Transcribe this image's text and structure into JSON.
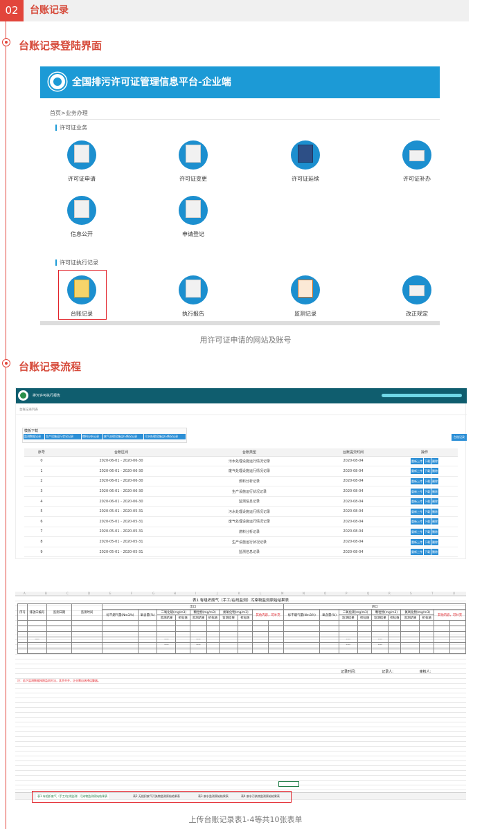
{
  "section": {
    "number": "02",
    "title": "台账记录"
  },
  "part1": {
    "heading": "台账记录登陆界面",
    "screenshot": {
      "topbar_title": "全国排污许可证管理信息平台-企业端",
      "breadcrumb": "首页>业务办理",
      "group1_label": "许可证业务",
      "group1_items": [
        "许可证申请",
        "许可证变更",
        "许可证延续",
        "许可证补办",
        "信息公开",
        "申请登记"
      ],
      "group2_label": "许可证执行记录",
      "group2_items": [
        "台账记录",
        "执行报告",
        "监测记录",
        "改正规定"
      ]
    },
    "caption": "用许可证申请的网站及账号"
  },
  "part2": {
    "heading": "台账记录流程",
    "app": {
      "title": "排污许可执行报告",
      "crumb": "台账记录列表",
      "download_label": "模板下载",
      "template_buttons": [
        "监测数据记录",
        "生产设施运行状况记录",
        "燃料分析记录",
        "废气治理设施运行情况记录",
        "污水处理设施运行情况记录"
      ],
      "right_button": "台账记录",
      "columns": [
        "序号",
        "台账区间",
        "台账类型",
        "台账提交时间",
        "操作"
      ],
      "ops": [
        "重新上传",
        "下载",
        "删除"
      ],
      "rows": [
        {
          "no": "0",
          "range": "2020-06-01 - 2020-06-30",
          "type": "污水处理设施运行情况记录",
          "date": "2020-08-04"
        },
        {
          "no": "1",
          "range": "2020-06-01 - 2020-06-30",
          "type": "废气处理设施运行情况记录",
          "date": "2020-08-04"
        },
        {
          "no": "2",
          "range": "2020-06-01 - 2020-06-30",
          "type": "燃料分析记录",
          "date": "2020-08-04"
        },
        {
          "no": "3",
          "range": "2020-06-01 - 2020-06-30",
          "type": "生产设施运行状况记录",
          "date": "2020-08-04"
        },
        {
          "no": "4",
          "range": "2020-06-01 - 2020-06-30",
          "type": "监测信息记录",
          "date": "2020-08-04"
        },
        {
          "no": "5",
          "range": "2020-05-01 - 2020-05-31",
          "type": "污水处理设施运行情况记录",
          "date": "2020-08-04"
        },
        {
          "no": "6",
          "range": "2020-05-01 - 2020-05-31",
          "type": "废气处理设施运行情况记录",
          "date": "2020-08-04"
        },
        {
          "no": "7",
          "range": "2020-05-01 - 2020-05-31",
          "type": "燃料分析记录",
          "date": "2020-08-04"
        },
        {
          "no": "8",
          "range": "2020-05-01 - 2020-05-31",
          "type": "生产设施运行状况记录",
          "date": "2020-08-04"
        },
        {
          "no": "9",
          "range": "2020-05-01 - 2020-05-31",
          "type": "监测信息记录",
          "date": "2020-08-04"
        }
      ]
    },
    "sheet": {
      "col_letters": [
        "A",
        "B",
        "C",
        "D",
        "E",
        "F",
        "G",
        "H",
        "I",
        "J",
        "K",
        "L",
        "M",
        "N",
        "O",
        "P",
        "Q",
        "R",
        "S",
        "T",
        "U"
      ],
      "title": "表1 有组织废气（手工/在线监测）污染物监测原始结果表",
      "outlet": "出口",
      "inlet": "进口",
      "headers": {
        "seq": "序号",
        "port": "排放口编号",
        "date": "监测日期",
        "time": "监测时间",
        "flow": "标干烟气量(Nm3/h)",
        "oxygen": "氧含量(%)",
        "so2": "二氧化硫(mg/m3)",
        "pm": "颗粒物(mg/m3)",
        "nox": "氮氧化物(mg/m3)",
        "other": "其他内容，可补充",
        "measured": "监测结果",
        "converted": "折标值"
      },
      "dash": "----",
      "record_time": "记录时间:",
      "recorder": "记录人:",
      "reviewer": "审核人:",
      "note": "注：若下监测数据按照监测方法，其余齐齐，企业需自选择运算器。",
      "tabs": [
        "表1 有组织废气（手工/在线监测）污染物监测原始结果表",
        "表2 无组织废气污染物监测原始结果表",
        "表3 废水监测原始结果表",
        "表4 废水污染物监测原始结果表"
      ]
    },
    "caption": "上传台账记录表1-4等共10张表单"
  }
}
